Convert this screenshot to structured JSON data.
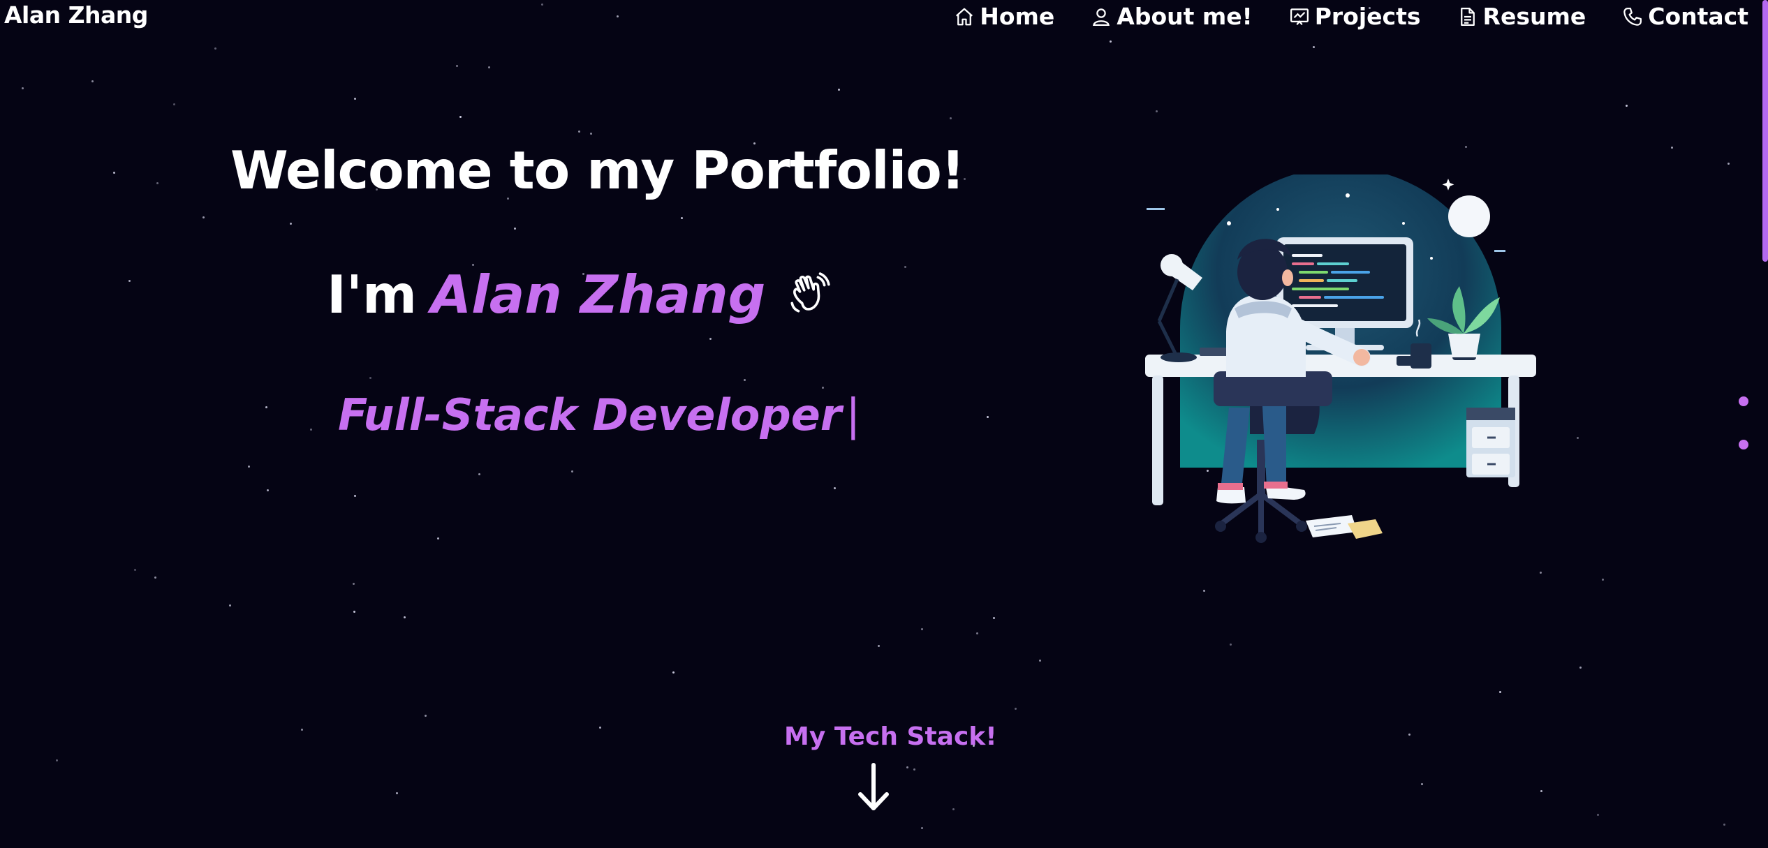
{
  "brand": "Alan Zhang",
  "nav": {
    "items": [
      {
        "label": "Home",
        "icon": "home-icon"
      },
      {
        "label": "About me!",
        "icon": "user-icon"
      },
      {
        "label": "Projects",
        "icon": "projects-icon"
      },
      {
        "label": "Resume",
        "icon": "document-icon"
      },
      {
        "label": "Contact",
        "icon": "phone-icon"
      }
    ]
  },
  "hero": {
    "headline": "Welcome to my Portfolio!",
    "intro_prefix": "I'm",
    "name": "Alan Zhang",
    "wave_icon": "waving-hand-icon",
    "role": "Full-Stack Developer",
    "cursor": "|"
  },
  "tech_stack": {
    "label": "My Tech Stack!",
    "arrow_icon": "arrow-down-icon"
  },
  "colors": {
    "background": "#050414",
    "accent": "#c770f0",
    "text": "#ffffff"
  }
}
